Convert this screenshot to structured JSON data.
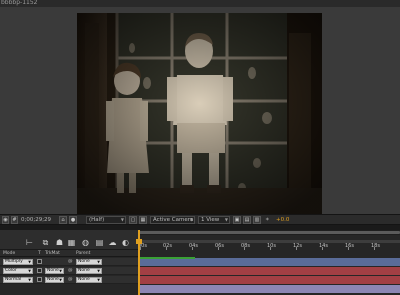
{
  "window": {
    "tab_label": "bbbbp-1152"
  },
  "viewer_toolbar": {
    "magnification": "(Half)",
    "timecode": "0;00;29;29",
    "camera": "Active Camera",
    "views": "1 View",
    "offset": "+0.0"
  },
  "timeline": {
    "ruler_ticks": [
      "00s",
      "02s",
      "04s",
      "06s",
      "08s",
      "10s",
      "12s",
      "14s",
      "16s",
      "18s"
    ],
    "columns": {
      "mode": "Mode",
      "t": "T",
      "trkmat": "TrkMat",
      "parent": "Parent"
    },
    "layers": [
      {
        "mode": "Multiply",
        "trkmat": "",
        "parent": "None",
        "color": "#5a6c99"
      },
      {
        "mode": "Color",
        "trkmat": "None",
        "parent": "None",
        "color": "#a23f44"
      },
      {
        "mode": "Normal",
        "trkmat": "None",
        "parent": "None",
        "color": "#8c86b4"
      }
    ]
  },
  "colors": {
    "cti": "#e0a020",
    "green_bar": "#3aa035"
  }
}
